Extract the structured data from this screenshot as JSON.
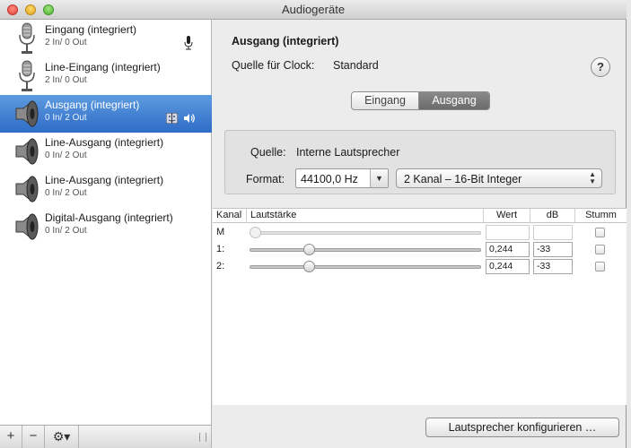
{
  "window": {
    "title": "Audiogeräte"
  },
  "devices": [
    {
      "name": "Eingang (integriert)",
      "io": "2 In/ 0 Out",
      "icon": "microphone-icon",
      "selected": false
    },
    {
      "name": "Line-Eingang (integriert)",
      "io": "2 In/ 0 Out",
      "icon": "microphone-icon",
      "selected": false
    },
    {
      "name": "Ausgang (integriert)",
      "io": "0 In/ 2 Out",
      "icon": "speaker-icon",
      "selected": true
    },
    {
      "name": "Line-Ausgang (integriert)",
      "io": "0 In/ 2 Out",
      "icon": "speaker-icon",
      "selected": false
    },
    {
      "name": "Line-Ausgang (integriert)",
      "io": "0 In/ 2 Out",
      "icon": "speaker-icon",
      "selected": false
    },
    {
      "name": "Digital-Ausgang (integriert)",
      "io": "0 In/ 2 Out",
      "icon": "speaker-icon",
      "selected": false
    }
  ],
  "sidebar_toolbar": {
    "add": "+",
    "remove": "−",
    "gear": "⚙▾"
  },
  "detail": {
    "title": "Ausgang (integriert)",
    "clock_label": "Quelle für Clock:",
    "clock_value": "Standard",
    "help": "?",
    "tabs": {
      "input": "Eingang",
      "output": "Ausgang",
      "active": "output"
    },
    "source_label": "Quelle:",
    "source_value": "Interne Lautsprecher",
    "format_label": "Format:",
    "sample_rate": "44100,0 Hz",
    "channel_format": "2 Kanal – 16-Bit Integer"
  },
  "table": {
    "headers": {
      "channel": "Kanal",
      "volume": "Lautstärke",
      "value": "Wert",
      "db": "dB",
      "mute": "Stumm"
    },
    "rows": [
      {
        "channel": "M",
        "value": "",
        "db": "",
        "level": 0.0,
        "enabled": false,
        "muted": false
      },
      {
        "channel": "1:",
        "value": "0,244",
        "db": "-33",
        "level": 0.244,
        "enabled": true,
        "muted": false
      },
      {
        "channel": "2:",
        "value": "0,244",
        "db": "-33",
        "level": 0.244,
        "enabled": true,
        "muted": false
      }
    ]
  },
  "configure_button": "Lautsprecher konfigurieren …"
}
